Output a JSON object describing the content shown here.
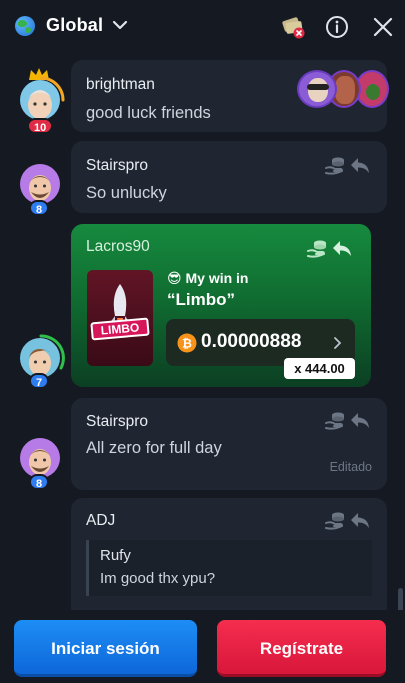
{
  "header": {
    "title": "Global",
    "icons": [
      "globe-icon",
      "chevron-down-icon",
      "rain-icon",
      "info-icon",
      "close-icon"
    ]
  },
  "messages": [
    {
      "user": "brightman",
      "text": "good luck friends",
      "level": "10",
      "has_crown": true
    },
    {
      "user": "Stairspro",
      "text": "So unlucky",
      "level": "8"
    },
    {
      "user": "Lacros90",
      "level": "7",
      "win_label": "😎 My win in",
      "game": "“Limbo”",
      "game_thumb_text": "LIMBO",
      "amount": "0.00000888",
      "multiplier": "x 444.00"
    },
    {
      "user": "Stairspro",
      "text": "All zero for full day",
      "level": "8",
      "edited": "Editado"
    },
    {
      "user": "ADJ",
      "quote_user": "Rufy",
      "quote_text": "Im good thx ypu?"
    }
  ],
  "buttons": {
    "login": "Iniciar sesión",
    "register": "Regístrate"
  },
  "colors": {
    "login": "#1d8df5",
    "register": "#f52d4f",
    "win_bg": "#168a3e",
    "level_red": "#e02b45",
    "level_blue": "#2f7cf0"
  }
}
